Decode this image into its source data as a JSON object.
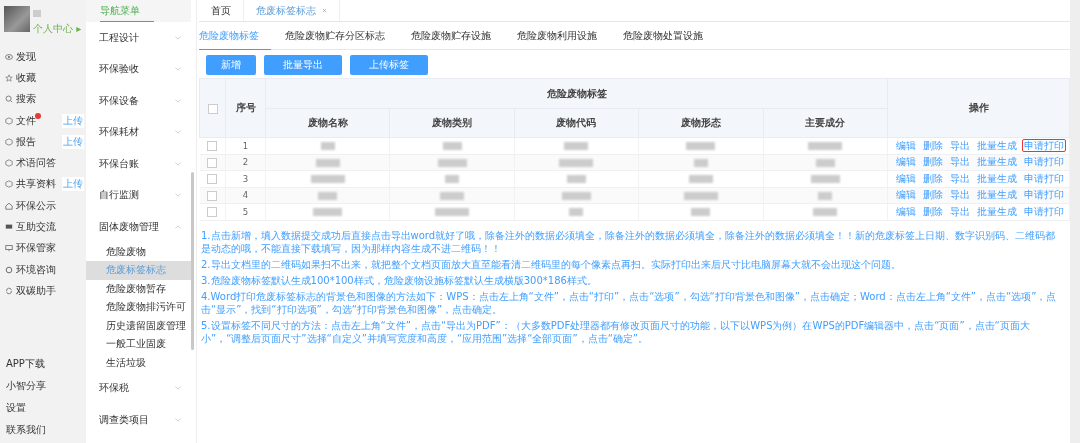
{
  "profile": {
    "link": "个人中心 ▸"
  },
  "sidebar": {
    "items": [
      {
        "label": "发现",
        "dot": false
      },
      {
        "label": "收藏",
        "dot": false
      },
      {
        "label": "搜索",
        "dot": false
      },
      {
        "label": "文件",
        "upload_badge": "上传",
        "dot": true
      },
      {
        "label": "报告",
        "upload_badge": "上传",
        "dot": false
      },
      {
        "label": "术语问答",
        "dot": false
      },
      {
        "label": "共享资料",
        "upload_badge": "上传",
        "dot": false
      },
      {
        "label": "环保公示",
        "dot": false
      },
      {
        "label": "互助交流",
        "dot": false
      },
      {
        "label": "环保管家",
        "dot": false
      },
      {
        "label": "环境咨询",
        "dot": false
      },
      {
        "label": "双碳助手",
        "dot": false
      }
    ],
    "bottom_links": [
      "APP下载",
      "小智分享",
      "设置",
      "联系我们"
    ]
  },
  "nav_menu": {
    "title": "导航菜单",
    "items": [
      {
        "label": "工程设计",
        "expanded": false
      },
      {
        "label": "环保验收",
        "expanded": false
      },
      {
        "label": "环保设备",
        "expanded": false
      },
      {
        "label": "环保耗材",
        "expanded": false
      },
      {
        "label": "环保台账",
        "expanded": false
      },
      {
        "label": "自行监测",
        "expanded": false
      },
      {
        "label": "固体废物管理",
        "expanded": true,
        "children": [
          {
            "label": "危险废物",
            "selected": false
          },
          {
            "label": "危废标签标志",
            "selected": true
          },
          {
            "label": "危险废物暂存",
            "selected": false
          },
          {
            "label": "危险废物排污许可",
            "selected": false
          },
          {
            "label": "历史遗留固废管理",
            "selected": false
          },
          {
            "label": "一般工业固废",
            "selected": false
          },
          {
            "label": "生活垃圾",
            "selected": false
          }
        ]
      },
      {
        "label": "环保税",
        "expanded": false
      },
      {
        "label": "调查类项目",
        "expanded": false
      }
    ]
  },
  "page_tabs": [
    {
      "label": "首页",
      "selected": false,
      "closable": false
    },
    {
      "label": "危废标签标志",
      "selected": true,
      "closable": true
    }
  ],
  "sub_tabs": [
    {
      "label": "危险废物标签",
      "selected": true
    },
    {
      "label": "危险废物贮存分区标志",
      "selected": false
    },
    {
      "label": "危险废物贮存设施",
      "selected": false
    },
    {
      "label": "危险废物利用设施",
      "selected": false
    },
    {
      "label": "危险废物处置设施",
      "selected": false
    }
  ],
  "toolbar": [
    "新增",
    "批量导出",
    "上传标签"
  ],
  "table": {
    "header_checked": false,
    "seq_header": "序号",
    "group_header": "危险废物标签",
    "columns": [
      "废物名称",
      "废物类别",
      "废物代码",
      "废物形态",
      "主要成分"
    ],
    "actions_header": "操作",
    "rows": [
      {
        "seq": "1",
        "checked": false,
        "actions": [
          {
            "label": "编辑",
            "highlighted": false
          },
          {
            "label": "删除",
            "highlighted": false
          },
          {
            "label": "导出",
            "highlighted": false
          },
          {
            "label": "批量生成",
            "highlighted": false
          },
          {
            "label": "申请打印",
            "highlighted": true
          }
        ]
      },
      {
        "seq": "2",
        "checked": false,
        "actions": [
          {
            "label": "编辑",
            "highlighted": false
          },
          {
            "label": "删除",
            "highlighted": false
          },
          {
            "label": "导出",
            "highlighted": false
          },
          {
            "label": "批量生成",
            "highlighted": false
          },
          {
            "label": "申请打印",
            "highlighted": false
          }
        ]
      },
      {
        "seq": "3",
        "checked": false,
        "actions": [
          {
            "label": "编辑",
            "highlighted": false
          },
          {
            "label": "删除",
            "highlighted": false
          },
          {
            "label": "导出",
            "highlighted": false
          },
          {
            "label": "批量生成",
            "highlighted": false
          },
          {
            "label": "申请打印",
            "highlighted": false
          }
        ]
      },
      {
        "seq": "4",
        "checked": false,
        "actions": [
          {
            "label": "编辑",
            "highlighted": false
          },
          {
            "label": "删除",
            "highlighted": false
          },
          {
            "label": "导出",
            "highlighted": false
          },
          {
            "label": "批量生成",
            "highlighted": false
          },
          {
            "label": "申请打印",
            "highlighted": false
          }
        ]
      },
      {
        "seq": "5",
        "checked": false,
        "actions": [
          {
            "label": "编辑",
            "highlighted": false
          },
          {
            "label": "删除",
            "highlighted": false
          },
          {
            "label": "导出",
            "highlighted": false
          },
          {
            "label": "批量生成",
            "highlighted": false
          },
          {
            "label": "申请打印",
            "highlighted": false
          }
        ]
      }
    ]
  },
  "notes": [
    "1.点击新增，填入数据提交成功后直接点击导出word就好了哦，除备注外的数据必须填全，除备注外的数据必须填全，除备注外的数据必须填全！！新的危废标签上日期、数字识别码、二维码都是动态的哦，不能直接下载填写，因为那样内容生成不进二维码！！",
    "2.导出文档里的二维码如果扫不出来，就把整个文档页面放大直至能看清二维码里的每个像素点再扫。实际打印出来后尺寸比电脑屏幕大就不会出现这个问题。",
    "3.危险废物标签默认生成100*100样式，危险废物设施标签默认生成横版300*186样式。",
    "4.Word打印危废标签标志的背景色和图像的方法如下：WPS：点击左上角“文件”，点击“打印”，点击“选项”，勾选“打印背景色和图像”，点击确定；Word：点击左上角“文件”，点击“选项”，点击“显示”，找到“打印选项”，勾选“打印背景色和图像”，点击确定。",
    "5.设置标签不同尺寸的方法：点击左上角“文件”，点击“导出为PDF”：（大多数PDF处理器都有修改页面尺寸的功能，以下以WPS为例）在WPS的PDF编辑器中，点击“页面”，点击“页面大小”，“调整后页面尺寸”选择“自定义”并填写宽度和高度，“应用范围”选择“全部页面”，点击“确定”。"
  ]
}
